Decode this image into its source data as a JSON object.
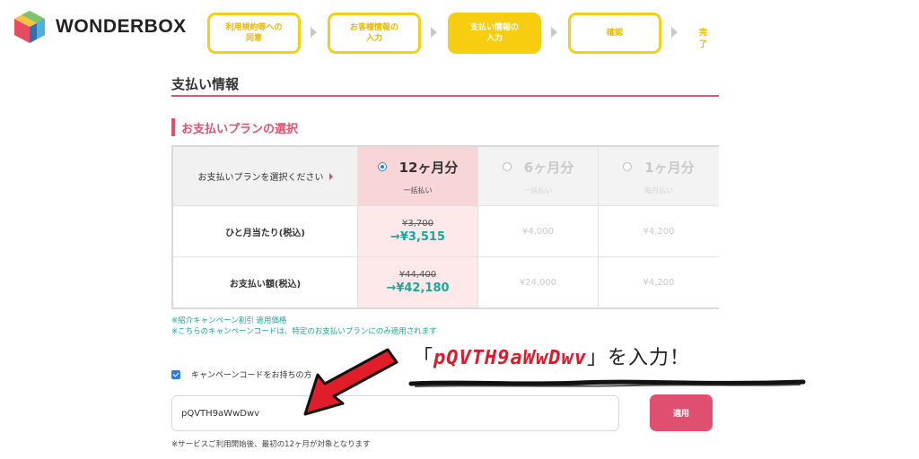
{
  "brand": {
    "name": "WONDERBOX",
    "logo_colors": [
      "#e94b5e",
      "#f6c343",
      "#4fb0d8",
      "#2f6fb7",
      "#7ec36b"
    ]
  },
  "steps": [
    {
      "label": "利用規約等への\n同意",
      "active": false
    },
    {
      "label": "お客様情報の\n入力",
      "active": false
    },
    {
      "label": "支払い情報の\n入力",
      "active": true
    },
    {
      "label": "確認",
      "active": false
    }
  ],
  "step_done": "完了",
  "page_title": "支払い情報",
  "section_title": "お支払いプランの選択",
  "plan_table": {
    "select_label": "お支払いプランを選択ください",
    "row_monthly_label": "ひと月当たり(税込)",
    "row_total_label": "お支払い額(税込)",
    "plans": [
      {
        "name": "12ヶ月分",
        "sub": "一括払い",
        "selected": true,
        "monthly_old": "¥3,700",
        "monthly_new": "→¥3,515",
        "total_old": "¥44,400",
        "total_new": "→¥42,180"
      },
      {
        "name": "6ヶ月分",
        "sub": "一括払い",
        "selected": false,
        "monthly": "¥4,000",
        "total": "¥24,000"
      },
      {
        "name": "1ヶ月分",
        "sub": "毎月払い",
        "selected": false,
        "monthly": "¥4,200",
        "total": "¥4,200"
      }
    ]
  },
  "notes": {
    "line1": "※紹介キャンペーン割引 適用価格",
    "line2": "※こちらのキャンペーンコードは、特定のお支払いプランにのみ適用されます"
  },
  "campaign": {
    "checkbox_label": "キャンペーンコードをお持ちの方",
    "checked": true,
    "code_value": "pQVTH9aWwDwv",
    "apply_label": "適用",
    "footnote": "※サービスご利用開始後、最初の12ヶ月が対象となります"
  },
  "annotation": {
    "open_bracket": "「",
    "code": "pQVTH9aWwDwv",
    "close_bracket": "」",
    "suffix": "を入力！"
  },
  "colors": {
    "accent_pink": "#e04f6f",
    "step_yellow": "#f6cd0f",
    "teal_price": "#1aa79a",
    "annotation_red": "#d81c2c"
  }
}
